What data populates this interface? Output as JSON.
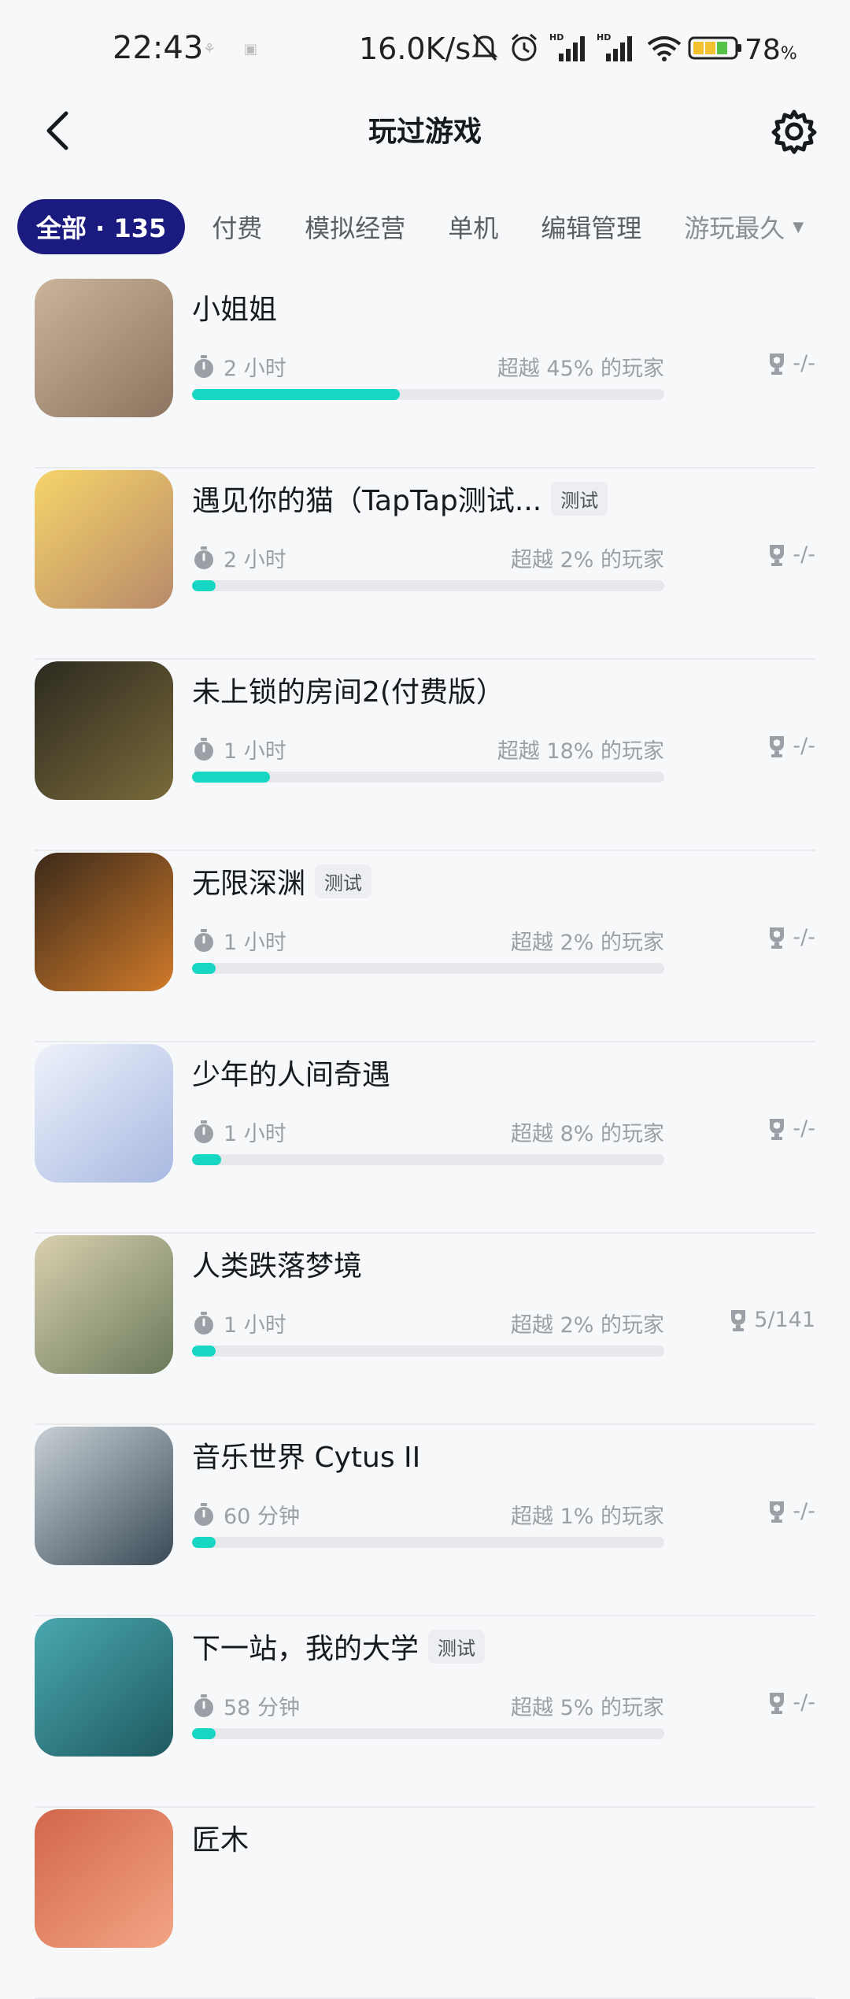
{
  "status_bar": {
    "time": "22:43",
    "network_speed": "16.0K/s",
    "battery_percent": "78",
    "battery_unit": "%"
  },
  "header": {
    "title": "玩过游戏"
  },
  "filters": {
    "active": "全部 · 135",
    "items": [
      "付费",
      "模拟经营",
      "单机",
      "编辑管理"
    ],
    "sort": "游玩最久"
  },
  "games": [
    {
      "name": "小姐姐",
      "tag": "",
      "time": "2 小时",
      "rank": "超越 45% 的玩家",
      "achievement": "-/-",
      "progress": 0.44,
      "thumb_colors": [
        "#c9b49a",
        "#8c7560"
      ]
    },
    {
      "name": "遇见你的猫（TapTap测试...",
      "tag": "测试",
      "time": "2 小时",
      "rank": "超越 2% 的玩家",
      "achievement": "-/-",
      "progress": 0.05,
      "thumb_colors": [
        "#f6d46a",
        "#b88a6a"
      ]
    },
    {
      "name": "未上锁的房间2(付费版）",
      "tag": "",
      "time": "1 小时",
      "rank": "超越 18% 的玩家",
      "achievement": "-/-",
      "progress": 0.165,
      "thumb_colors": [
        "#2c2a20",
        "#7a6a3a"
      ]
    },
    {
      "name": "无限深渊",
      "tag": "测试",
      "time": "1 小时",
      "rank": "超越 2% 的玩家",
      "achievement": "-/-",
      "progress": 0.05,
      "thumb_colors": [
        "#3b2a1a",
        "#d07a2a"
      ]
    },
    {
      "name": "少年的人间奇遇",
      "tag": "",
      "time": "1 小时",
      "rank": "超越 8% 的玩家",
      "achievement": "-/-",
      "progress": 0.062,
      "thumb_colors": [
        "#eef2fb",
        "#a8b8e0"
      ]
    },
    {
      "name": "人类跌落梦境",
      "tag": "",
      "time": "1 小时",
      "rank": "超越 2% 的玩家",
      "achievement": "5/141",
      "progress": 0.05,
      "thumb_colors": [
        "#d9d0b0",
        "#6a7a5a"
      ]
    },
    {
      "name": "音乐世界 Cytus II",
      "tag": "",
      "time": "60 分钟",
      "rank": "超越 1% 的玩家",
      "achievement": "-/-",
      "progress": 0.05,
      "thumb_colors": [
        "#c8d0d6",
        "#3a4a56"
      ]
    },
    {
      "name": "下一站，我的大学",
      "tag": "测试",
      "time": "58 分钟",
      "rank": "超越 5% 的玩家",
      "achievement": "-/-",
      "progress": 0.05,
      "thumb_colors": [
        "#4aa8b0",
        "#1f5a60"
      ]
    },
    {
      "name": "匠木",
      "tag": "",
      "time": "",
      "rank": "",
      "achievement": "",
      "progress": 0,
      "thumb_colors": [
        "#d2664a",
        "#f3a584"
      ]
    }
  ]
}
